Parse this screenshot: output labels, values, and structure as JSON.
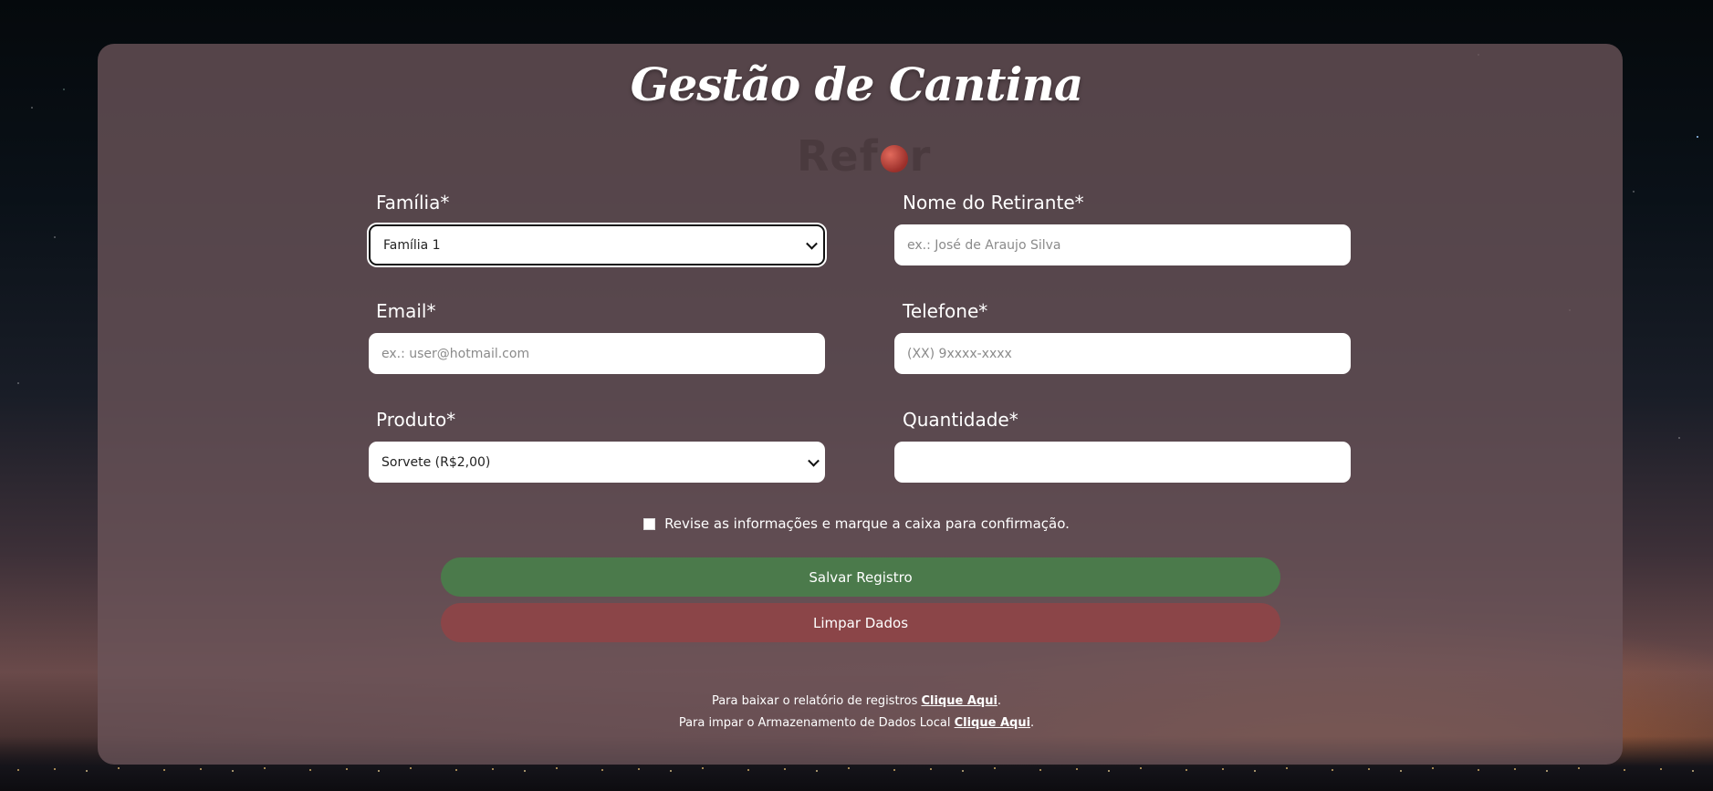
{
  "header": {
    "title": "Gestão de Cantina",
    "logo_text_left": "Ref",
    "logo_text_right": "r"
  },
  "form": {
    "familia": {
      "label": "Família*",
      "selected": "Família 1"
    },
    "nome_retirante": {
      "label": "Nome do Retirante*",
      "value": "",
      "placeholder": "ex.: José de Araujo Silva"
    },
    "email": {
      "label": "Email*",
      "value": "",
      "placeholder": "ex.: user@hotmail.com"
    },
    "telefone": {
      "label": "Telefone*",
      "value": "",
      "placeholder": "(XX) 9xxxx-xxxx"
    },
    "produto": {
      "label": "Produto*",
      "selected": "Sorvete (R$2,00)"
    },
    "quantidade": {
      "label": "Quantidade*",
      "value": ""
    },
    "confirm": {
      "label": "Revise as informações e marque a caixa para confirmação.",
      "checked": false
    }
  },
  "buttons": {
    "save_label": "Salvar Registro",
    "clear_label": "Limpar Dados"
  },
  "footer": {
    "report_text": "Para baixar o relatório de registros ",
    "report_link": "Clique Aqui",
    "clear_storage_text": "Para impar o Armazenamento de Dados Local ",
    "clear_storage_link": "Clique Aqui",
    "period": "."
  },
  "colors": {
    "panel": "#6c545a",
    "save_button": "#4b7a4b",
    "clear_button": "#8b4548",
    "text": "#ffffff"
  },
  "icons": {
    "select_arrow": "chevron-down-icon",
    "logo_apple": "apple-icon"
  }
}
